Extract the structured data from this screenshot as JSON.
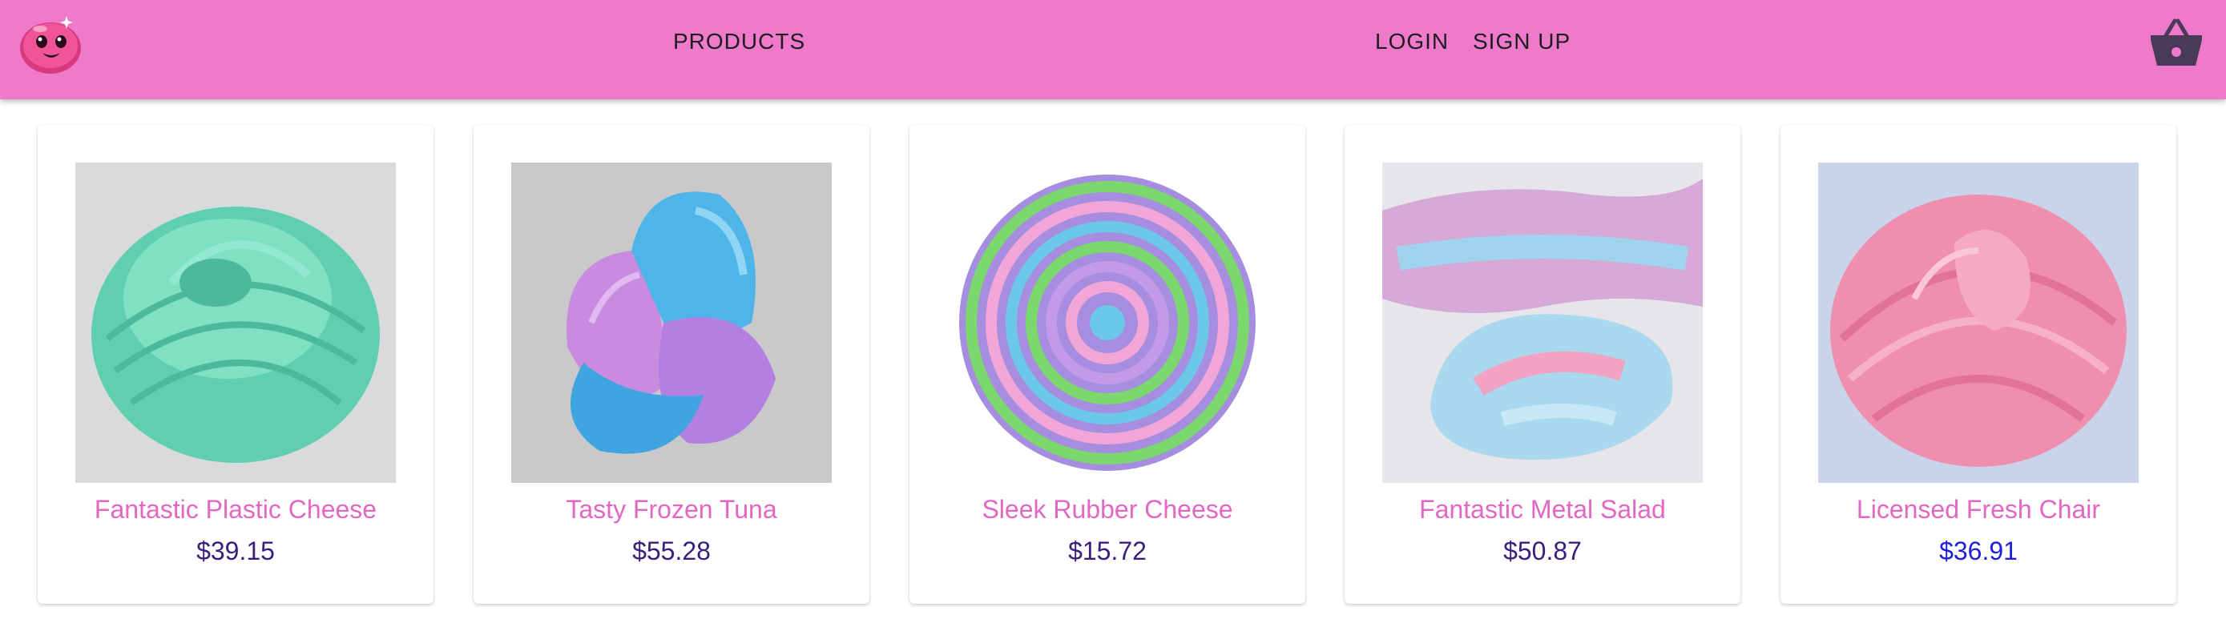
{
  "header": {
    "logo_icon": "slime-mascot-icon",
    "nav": {
      "products": "PRODUCTS",
      "login": "LOGIN",
      "signup": "SIGN UP"
    },
    "cart_icon": "shopping-basket-icon",
    "background": "#ef7acb"
  },
  "products": [
    {
      "name": "Fantastic Plastic Cheese",
      "price": "$39.15",
      "image": "mint-green-slime-image"
    },
    {
      "name": "Tasty Frozen Tuna",
      "price": "$55.28",
      "image": "blue-purple-glitter-slime-image"
    },
    {
      "name": "Sleek Rubber Cheese",
      "price": "$15.72",
      "image": "rainbow-swirl-slime-image"
    },
    {
      "name": "Fantastic Metal Salad",
      "price": "$50.87",
      "image": "pastel-cloud-slime-image"
    },
    {
      "name": "Licensed Fresh Chair",
      "price": "$36.91",
      "image": "pink-slime-image"
    }
  ],
  "colors": {
    "product_name": "#e367c2",
    "price": "#3a1d7c",
    "price_highlight": "#1f1fe0"
  }
}
